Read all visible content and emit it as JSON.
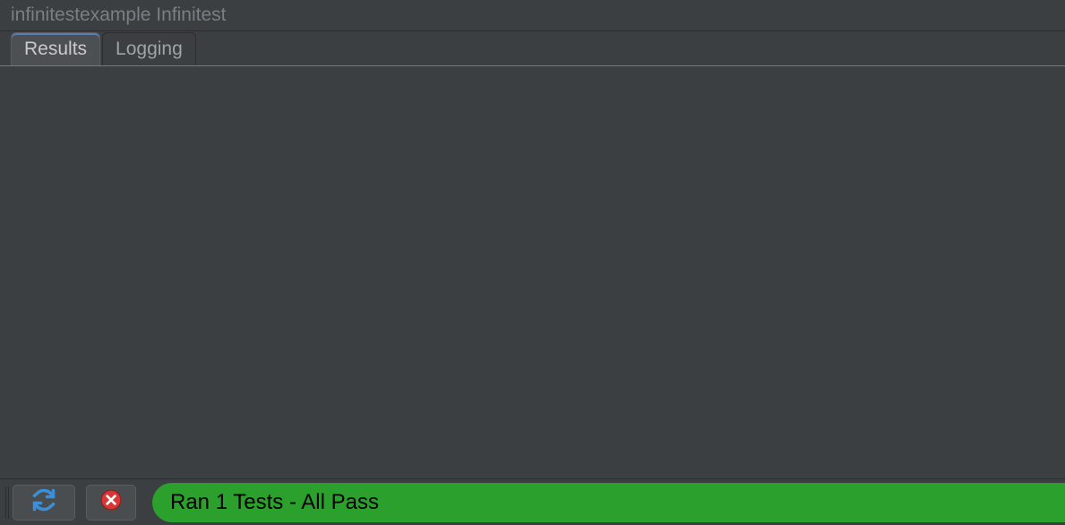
{
  "title": "infinitestexample Infinitest",
  "tabs": {
    "results": {
      "label": "Results",
      "active": true
    },
    "logging": {
      "label": "Logging",
      "active": false
    }
  },
  "status": {
    "message": "Ran 1 Tests - All Pass",
    "color": "#2ca02c"
  },
  "icons": {
    "refresh": "refresh-icon",
    "cancel": "cancel-icon"
  }
}
